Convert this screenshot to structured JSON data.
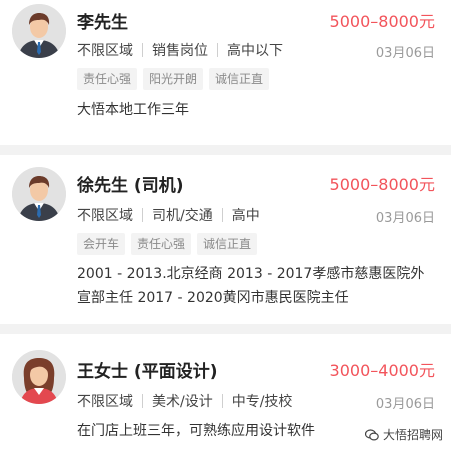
{
  "listings": [
    {
      "name": "李先生",
      "salary": "5000–8000元",
      "meta": [
        "不限区域",
        "销售岗位",
        "高中以下"
      ],
      "date": "03月06日",
      "tags": [
        "责任心强",
        "阳光开朗",
        "诚信正直"
      ],
      "description": "大悟本地工作三年",
      "avatar": "male-avatar-icon"
    },
    {
      "name": "徐先生 (司机)",
      "salary": "5000–8000元",
      "meta": [
        "不限区域",
        "司机/交通",
        "高中"
      ],
      "date": "03月06日",
      "tags": [
        "会开车",
        "责任心强",
        "诚信正直"
      ],
      "description": "2001 - 2013.北京经商 2013 - 2017孝感市慈惠医院外宣部主任 2017 - 2020黄冈市惠民医院主任",
      "avatar": "male-avatar-icon"
    },
    {
      "name": "王女士 (平面设计)",
      "salary": "3000–4000元",
      "meta": [
        "不限区域",
        "美术/设计",
        "中专/技校"
      ],
      "date": "03月06日",
      "tags": [],
      "description": "在门店上班三年，可熟练应用设计软件",
      "avatar": "female-avatar-icon"
    }
  ],
  "watermark": {
    "text": "大悟招聘网",
    "icon": "wechat-icon"
  },
  "colors": {
    "salary": "#f2545b",
    "background": "#f2f2f2",
    "tag_bg": "#f3f3f3",
    "tag_text": "#8a8a8a"
  }
}
